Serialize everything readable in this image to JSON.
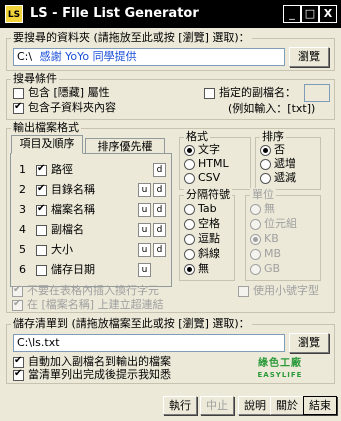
{
  "window": {
    "title": "LS - File List Generator",
    "icon_text": "LS",
    "minimize": "_",
    "maximize": "□",
    "close": "X"
  },
  "source": {
    "label": "要搜尋的資料夾 (請拖放至此或按 [瀏覽] 選取)：",
    "path_prefix": "C:\\",
    "path_value": "感謝 YoYo 同學提供",
    "browse": "瀏覽"
  },
  "search": {
    "label": "搜尋條件",
    "hidden": "包含 [隱藏] 屬性",
    "subfolders": "包含子資料夾內容",
    "ext_label": "指定的副檔名：",
    "ext_example": "(例如輸入：[txt])"
  },
  "output": {
    "label": "輸出檔案格式",
    "tab_items": "項目及順序",
    "tab_sort": "排序優先權",
    "items": [
      {
        "num": "1",
        "label": "路徑",
        "checked": true,
        "u": "",
        "d": "d"
      },
      {
        "num": "2",
        "label": "目錄名稱",
        "checked": true,
        "u": "u",
        "d": "d"
      },
      {
        "num": "3",
        "label": "檔案名稱",
        "checked": true,
        "u": "u",
        "d": "d"
      },
      {
        "num": "4",
        "label": "副檔名",
        "checked": false,
        "u": "u",
        "d": "d"
      },
      {
        "num": "5",
        "label": "大小",
        "checked": false,
        "u": "u",
        "d": "d"
      },
      {
        "num": "6",
        "label": "儲存日期",
        "checked": false,
        "u": "u",
        "d": ""
      }
    ],
    "no_newline": "不要在表格內插入換行字元",
    "hyperlink": "在 [檔案名稱] 上建立超連結",
    "small_font": "使用小號字型"
  },
  "format": {
    "label": "格式",
    "options": [
      "文字",
      "HTML",
      "CSV"
    ],
    "selected": 0
  },
  "sort": {
    "label": "排序",
    "options": [
      "否",
      "遞增",
      "遞減"
    ],
    "selected": 0
  },
  "separator": {
    "label": "分隔符號",
    "options": [
      "Tab",
      "空格",
      "逗點",
      "斜線",
      "無"
    ],
    "selected": 4
  },
  "unit": {
    "label": "單位",
    "options": [
      "無",
      "位元組",
      "KB",
      "MB",
      "GB"
    ],
    "selected": 2
  },
  "save": {
    "label": "儲存清單到 (請拖放檔案至此或按 [瀏覽] 選取)：",
    "path": "C:\\ls.txt",
    "browse": "瀏覽",
    "auto_ext": "自動加入副檔名到輸出的檔案",
    "notify": "當清單列出完成後提示我知悉"
  },
  "logo": {
    "line1": "綠色工廠",
    "line2": "EASYLIFE"
  },
  "buttons": {
    "run": "執行",
    "stop": "中止",
    "help": "說明",
    "about": "關於",
    "exit": "結束"
  },
  "colors": {
    "link_blue": "#1a4fd8",
    "logo_green": "#2a9a3a"
  }
}
